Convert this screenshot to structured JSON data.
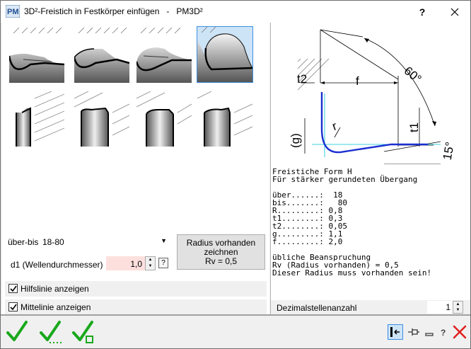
{
  "window": {
    "title": "3D²-Freistich in Festkörper einfügen   -   PM3D²",
    "help_label": "?",
    "close_icon": "close-icon",
    "app_icon": "pm-app-icon"
  },
  "thumbnails": [
    {
      "id": "undercut-form-e",
      "selected": false
    },
    {
      "id": "undercut-form-f",
      "selected": false
    },
    {
      "id": "undercut-form-g",
      "selected": false
    },
    {
      "id": "undercut-form-h",
      "selected": true
    },
    {
      "id": "undercut-form-e-half",
      "selected": false
    },
    {
      "id": "undercut-form-f-half",
      "selected": false
    },
    {
      "id": "undercut-form-g-half",
      "selected": false
    },
    {
      "id": "undercut-form-h-half",
      "selected": false
    }
  ],
  "controls": {
    "range_label": "über-bis",
    "range_value": "18-80",
    "diameter_label": "d1  (Wellendurchmesser)",
    "diameter_value": "1,0",
    "diameter_help": "?",
    "radius_button": [
      "Radius vorhanden",
      "zeichnen",
      "Rv = 0,5"
    ],
    "helpline_label": "Hilfslinie anzeigen",
    "helpline_checked": true,
    "centerline_label": "Mittelinie anzeigen",
    "centerline_checked": true
  },
  "diagram": {
    "labels": {
      "t2": "t2",
      "f": "f",
      "angle60": "60°",
      "t1": "t1",
      "g": "(g)",
      "r": "r",
      "angle15": "15°"
    }
  },
  "info": {
    "lines": [
      "Freistiche Form H",
      "Für stärker gerundeten Übergang",
      "",
      "über......:  18",
      "bis.......:   80",
      "R.........: 0,8",
      "t1........: 0,3",
      "t2........: 0,05",
      "g.........: 1,1",
      "f.........: 2,0",
      "",
      "übliche Beanspruchung",
      "Rv (Radius vorhanden) = 0,5",
      "Dieser Radius muss vorhanden sein!"
    ],
    "decimal_label": "Dezimalstellenanzahl",
    "decimal_value": "1"
  },
  "bottom": {
    "ok_icons": [
      "check-icon",
      "check-continue-icon",
      "check-new-icon"
    ],
    "tool_icons": [
      "panel-toggle-icon",
      "pin-icon",
      "minimize-icon",
      "help-icon",
      "cancel-icon"
    ],
    "accent_green": "#19a81c",
    "accent_red": "#e02020"
  }
}
